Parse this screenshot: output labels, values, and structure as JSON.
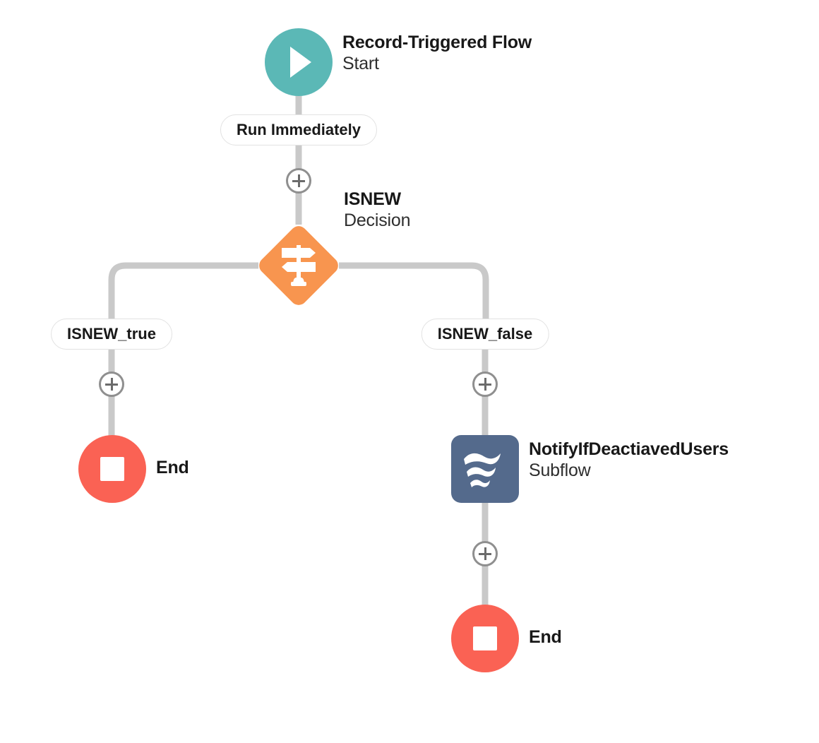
{
  "canvas": {
    "background_color": "#ffffff"
  },
  "colors": {
    "start": "#5bb8b6",
    "decision": "#f8954f",
    "subflow": "#546a8c",
    "end": "#fa6254",
    "connector": "#c9c9c9",
    "plus_border": "#8f8f8f",
    "pill_border": "#e2e2e2",
    "text": "#181818"
  },
  "nodes": {
    "start": {
      "name": "Record-Triggered Flow",
      "type": "Start",
      "icon": "play-icon"
    },
    "decision": {
      "name": "ISNEW",
      "type": "Decision",
      "icon": "signpost-icon"
    },
    "subflow": {
      "name": "NotifyIfDeactiavedUsers",
      "type": "Subflow",
      "icon": "subflow-waves-icon"
    },
    "end_left": {
      "name": "End",
      "icon": "stop-icon"
    },
    "end_right": {
      "name": "End",
      "icon": "stop-icon"
    }
  },
  "connectors": {
    "run_immediately_label": "Run Immediately",
    "branch_true_label": "ISNEW_true",
    "branch_false_label": "ISNEW_false"
  },
  "buttons": {
    "add_element": "+"
  }
}
